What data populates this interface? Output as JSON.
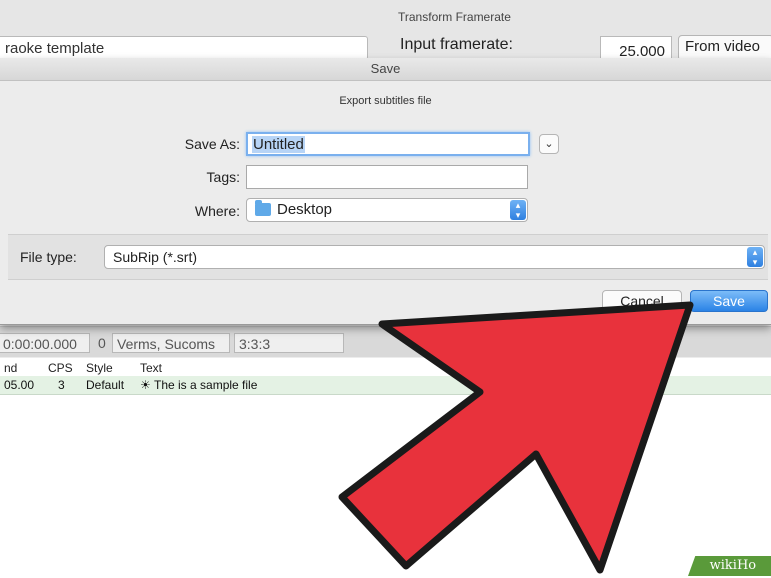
{
  "background": {
    "template_field_text": "raoke template",
    "framerate": {
      "title": "Transform Framerate",
      "input_label": "Input framerate:",
      "input_value": "25.000",
      "from_video_label": "From video"
    },
    "edit_strip": {
      "time_fragment": "0:00:00.000",
      "field_fragment": "0",
      "font_fragment": "Verms, Sucoms",
      "extra_fragment": "3:3:3"
    },
    "grid": {
      "headers": [
        "nd",
        "CPS",
        "Style",
        "Text"
      ],
      "rows": [
        {
          "end": "05.00",
          "cps": "3",
          "style": "Default",
          "text": "The is a sample file"
        }
      ]
    }
  },
  "dialog": {
    "window_title": "Save",
    "subtitle": "Export subtitles file",
    "save_as_label": "Save As:",
    "save_as_value": "Untitled",
    "tags_label": "Tags:",
    "tags_value": "",
    "where_label": "Where:",
    "where_value": "Desktop",
    "file_type_label": "File type:",
    "file_type_value": "SubRip (*.srt)",
    "cancel_label": "Cancel",
    "save_label": "Save"
  },
  "overlay": {
    "arrow_color": "#e8323c",
    "watermark": "wikiHo"
  },
  "colors": {
    "accent_blue": "#2b83e6",
    "selection_blue": "#b7d4f6",
    "row_highlight": "#e4f2e4"
  }
}
